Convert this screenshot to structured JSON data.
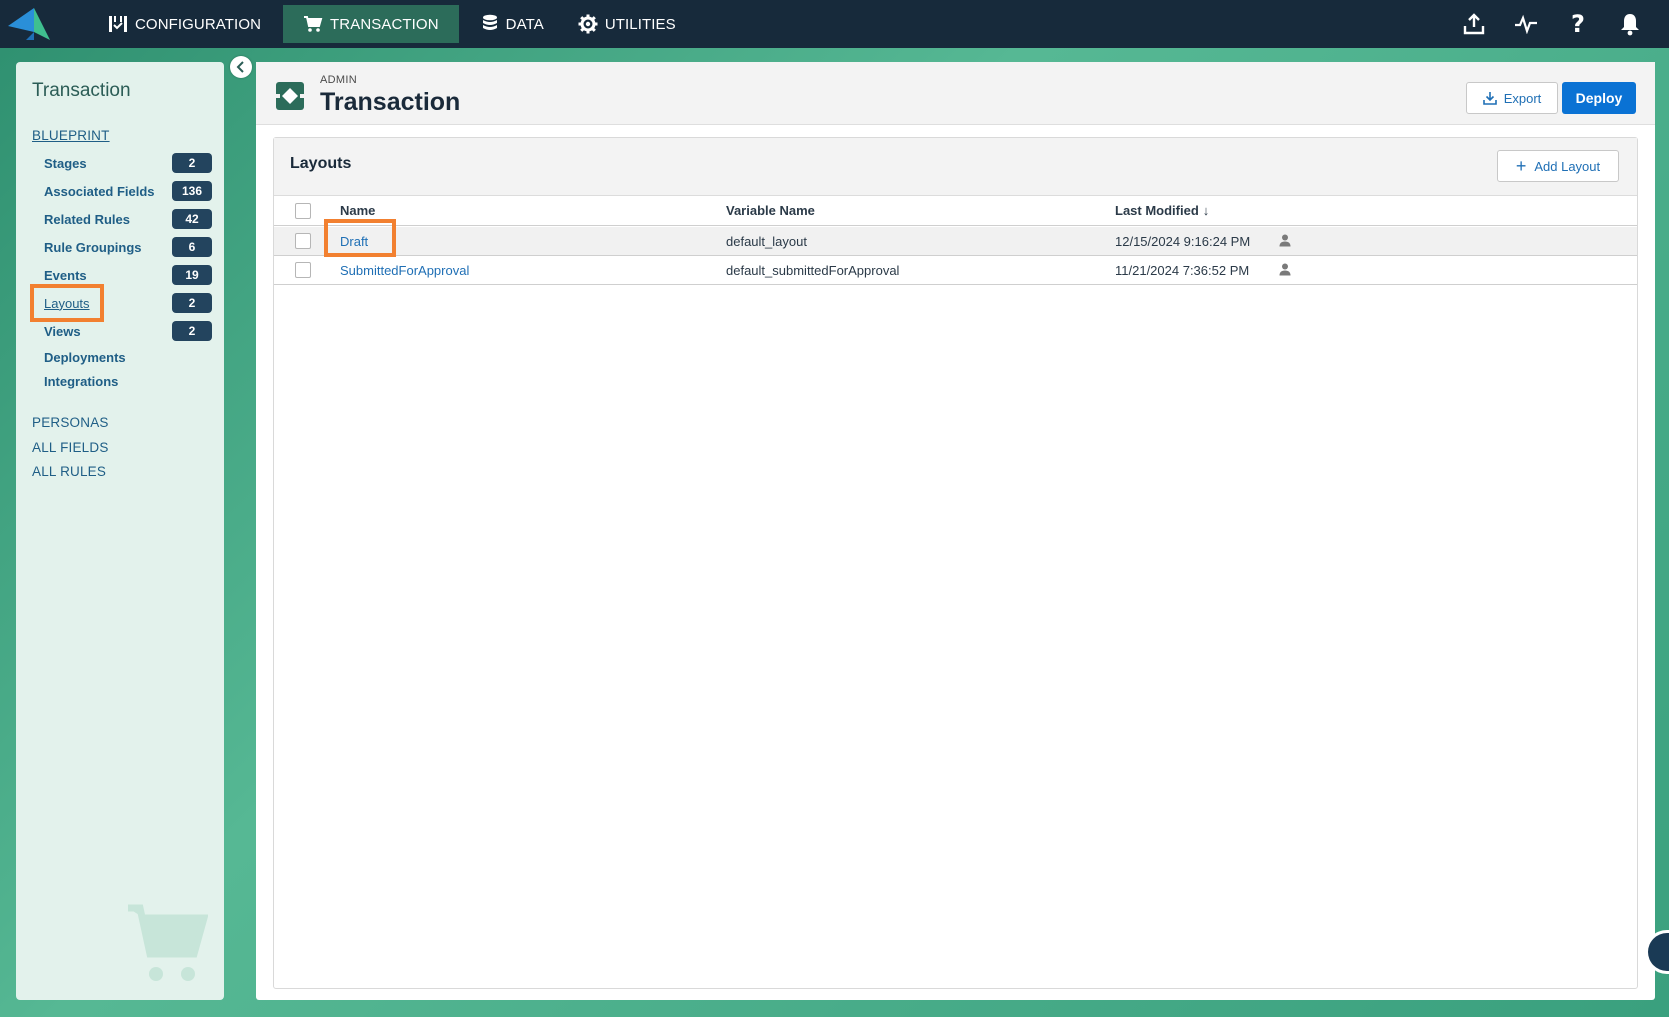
{
  "nav": {
    "items": [
      {
        "label": "CONFIGURATION",
        "icon": "configuration-icon",
        "active": false
      },
      {
        "label": "TRANSACTION",
        "icon": "cart-icon",
        "active": true
      },
      {
        "label": "DATA",
        "icon": "database-icon",
        "active": false
      },
      {
        "label": "UTILITIES",
        "icon": "gear-icon",
        "active": false
      }
    ],
    "right_icons": [
      "upload-icon",
      "activity-icon",
      "help-icon",
      "bell-icon"
    ]
  },
  "sidebar": {
    "title": "Transaction",
    "blueprint_label": "BLUEPRINT",
    "items": [
      {
        "label": "Stages",
        "count": "2"
      },
      {
        "label": "Associated Fields",
        "count": "136"
      },
      {
        "label": "Related Rules",
        "count": "42"
      },
      {
        "label": "Rule Groupings",
        "count": "6"
      },
      {
        "label": "Events",
        "count": "19"
      },
      {
        "label": "Layouts",
        "count": "2"
      },
      {
        "label": "Views",
        "count": "2"
      },
      {
        "label": "Deployments",
        "count": ""
      },
      {
        "label": "Integrations",
        "count": ""
      }
    ],
    "sections": [
      "PERSONAS",
      "ALL FIELDS",
      "ALL RULES"
    ]
  },
  "header": {
    "subtitle": "ADMIN",
    "title": "Transaction",
    "export_label": "Export",
    "deploy_label": "Deploy"
  },
  "layouts": {
    "title": "Layouts",
    "add_label": "Add Layout",
    "columns": {
      "name": "Name",
      "variable": "Variable Name",
      "modified": "Last Modified",
      "sort_arrow": "↓"
    },
    "rows": [
      {
        "name": "Draft",
        "variable": "default_layout",
        "modified": "12/15/2024 9:16:24 PM"
      },
      {
        "name": "SubmittedForApproval",
        "variable": "default_submittedForApproval",
        "modified": "11/21/2024 7:36:52 PM"
      }
    ]
  },
  "colors": {
    "topbar": "#172a3b",
    "active_nav": "#2c6c5a",
    "accent_blue": "#0a72d4",
    "highlight": "#f28030",
    "badge": "#23445e"
  }
}
